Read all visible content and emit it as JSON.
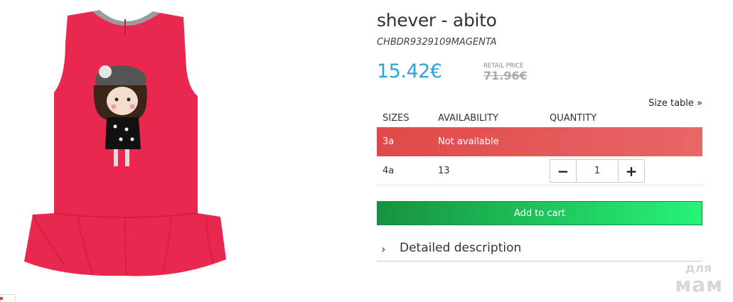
{
  "product": {
    "title": "shever - abito",
    "sku": "CHBDR9329109MAGENTA",
    "price": "15.42€",
    "retail_label": "RETAIL PRICE",
    "retail_price": "71.96€",
    "image_icon": "red-dress-product-image"
  },
  "size_table_link": "Size table »",
  "sizes": {
    "headers": [
      "SIZES",
      "AVAILABILITY",
      "QUANTITY"
    ],
    "rows": [
      {
        "size": "3a",
        "availability": "Not available"
      },
      {
        "size": "4a",
        "availability": "13"
      }
    ],
    "quantity": {
      "minus": "−",
      "value": "1",
      "plus": "+"
    }
  },
  "add_to_cart": "Add to cart",
  "description": {
    "chevron": "›",
    "label": "Detailed description"
  },
  "watermark": {
    "top": "для",
    "bottom": "мам"
  },
  "colors": {
    "price": "#2ea3d8",
    "unavailable_row": "#e04949",
    "cart_start": "#17923f",
    "cart_end": "#27f377",
    "dress": "#e8284e"
  }
}
